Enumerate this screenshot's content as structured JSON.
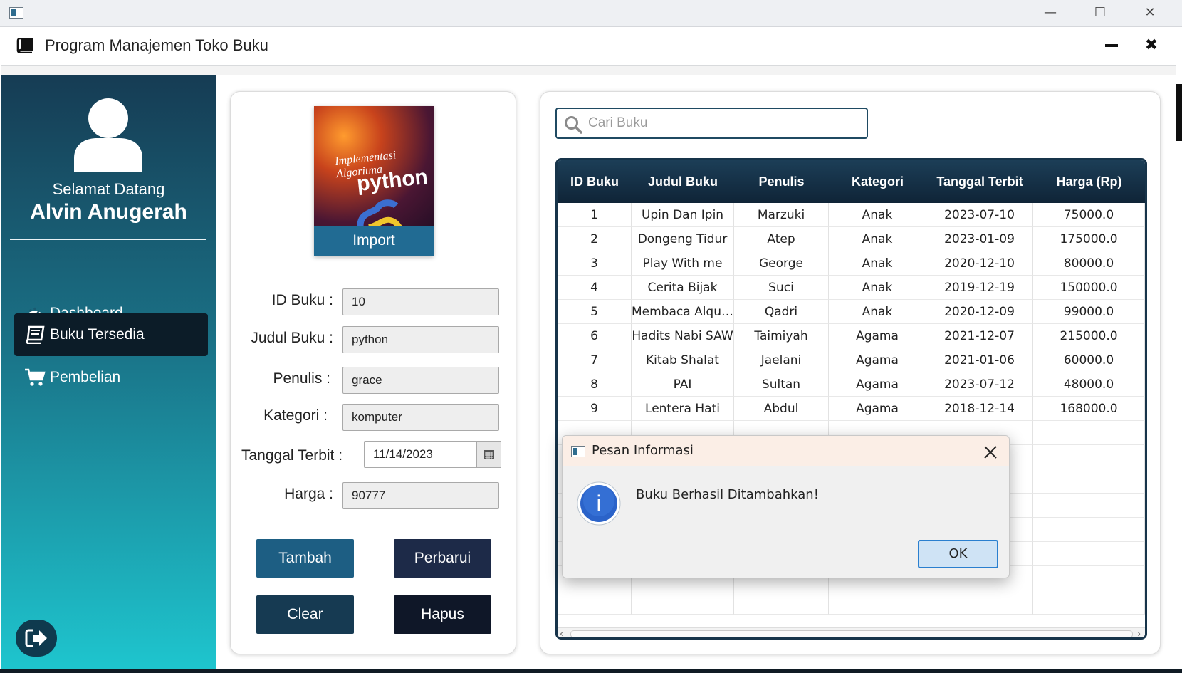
{
  "app": {
    "title": "Program Manajemen Toko Buku"
  },
  "sidebar": {
    "welcome": "Selamat Datang",
    "user_name": "Alvin Anugerah",
    "items": [
      {
        "label": "Dashboard",
        "icon": "gauge-icon",
        "active": false
      },
      {
        "label": "Buku Tersedia",
        "icon": "book-icon",
        "active": true
      },
      {
        "label": "Pembelian",
        "icon": "cart-icon",
        "active": false
      }
    ]
  },
  "form": {
    "cover": {
      "text_small": "Implementasi",
      "text_algoritma": "Algoritma",
      "text_title": "python"
    },
    "import_label": "Import",
    "fields": {
      "id": {
        "label": "ID Buku :",
        "value": "10"
      },
      "judul": {
        "label": "Judul Buku :",
        "value": "python"
      },
      "penulis": {
        "label": "Penulis :",
        "value": "grace"
      },
      "kategori": {
        "label": "Kategori :",
        "value": "komputer"
      },
      "tanggal": {
        "label": "Tanggal Terbit :",
        "value": "11/14/2023"
      },
      "harga": {
        "label": "Harga :",
        "value": "90777"
      }
    },
    "buttons": {
      "tambah": "Tambah",
      "perbarui": "Perbarui",
      "clear": "Clear",
      "hapus": "Hapus"
    }
  },
  "search": {
    "placeholder": "Cari Buku"
  },
  "table": {
    "columns": [
      "ID Buku",
      "Judul Buku",
      "Penulis",
      "Kategori",
      "Tanggal Terbit",
      "Harga (Rp)"
    ],
    "rows": [
      [
        "1",
        "Upin Dan Ipin",
        "Marzuki",
        "Anak",
        "2023-07-10",
        "75000.0"
      ],
      [
        "2",
        "Dongeng Tidur",
        "Atep",
        "Anak",
        "2023-01-09",
        "175000.0"
      ],
      [
        "3",
        "Play With me",
        "George",
        "Anak",
        "2020-12-10",
        "80000.0"
      ],
      [
        "4",
        "Cerita Bijak",
        "Suci",
        "Anak",
        "2019-12-19",
        "150000.0"
      ],
      [
        "5",
        "Membaca Alqur...",
        "Qadri",
        "Anak",
        "2020-12-09",
        "99000.0"
      ],
      [
        "6",
        "Hadits Nabi SAW",
        "Taimiyah",
        "Agama",
        "2021-12-07",
        "215000.0"
      ],
      [
        "7",
        "Kitab Shalat",
        "Jaelani",
        "Agama",
        "2021-01-06",
        "60000.0"
      ],
      [
        "8",
        "PAI",
        "Sultan",
        "Agama",
        "2023-07-12",
        "48000.0"
      ],
      [
        "9",
        "Lentera Hati",
        "Abdul",
        "Agama",
        "2018-12-14",
        "168000.0"
      ]
    ]
  },
  "dialog": {
    "title": "Pesan Informasi",
    "message": "Buku Berhasil Ditambahkan!",
    "ok_label": "OK",
    "icon_letter": "i"
  },
  "colors": {
    "sidebar_top": "#163c54",
    "sidebar_bottom": "#1ec6cf",
    "btn_tambah": "#1d5e83",
    "btn_perbarui": "#1d2a48",
    "btn_clear": "#163a52",
    "btn_hapus": "#0f1728"
  }
}
